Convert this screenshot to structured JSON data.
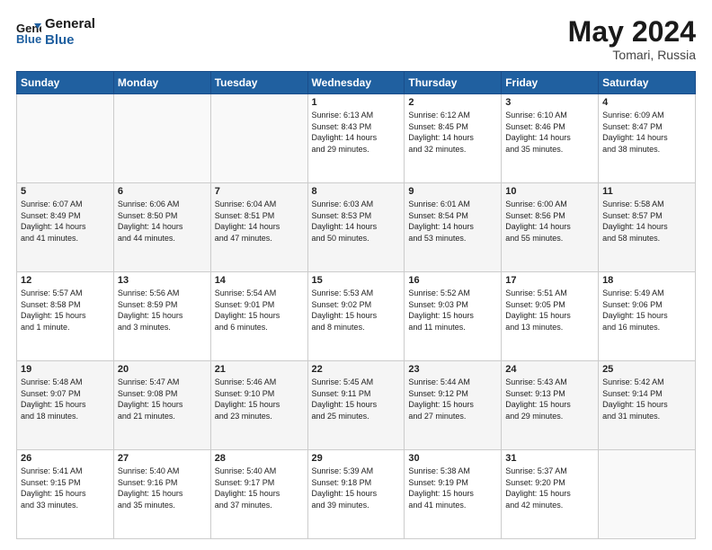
{
  "header": {
    "logo_line1": "General",
    "logo_line2": "Blue",
    "month_year": "May 2024",
    "location": "Tomari, Russia"
  },
  "weekdays": [
    "Sunday",
    "Monday",
    "Tuesday",
    "Wednesday",
    "Thursday",
    "Friday",
    "Saturday"
  ],
  "weeks": [
    [
      {
        "day": "",
        "info": ""
      },
      {
        "day": "",
        "info": ""
      },
      {
        "day": "",
        "info": ""
      },
      {
        "day": "1",
        "info": "Sunrise: 6:13 AM\nSunset: 8:43 PM\nDaylight: 14 hours\nand 29 minutes."
      },
      {
        "day": "2",
        "info": "Sunrise: 6:12 AM\nSunset: 8:45 PM\nDaylight: 14 hours\nand 32 minutes."
      },
      {
        "day": "3",
        "info": "Sunrise: 6:10 AM\nSunset: 8:46 PM\nDaylight: 14 hours\nand 35 minutes."
      },
      {
        "day": "4",
        "info": "Sunrise: 6:09 AM\nSunset: 8:47 PM\nDaylight: 14 hours\nand 38 minutes."
      }
    ],
    [
      {
        "day": "5",
        "info": "Sunrise: 6:07 AM\nSunset: 8:49 PM\nDaylight: 14 hours\nand 41 minutes."
      },
      {
        "day": "6",
        "info": "Sunrise: 6:06 AM\nSunset: 8:50 PM\nDaylight: 14 hours\nand 44 minutes."
      },
      {
        "day": "7",
        "info": "Sunrise: 6:04 AM\nSunset: 8:51 PM\nDaylight: 14 hours\nand 47 minutes."
      },
      {
        "day": "8",
        "info": "Sunrise: 6:03 AM\nSunset: 8:53 PM\nDaylight: 14 hours\nand 50 minutes."
      },
      {
        "day": "9",
        "info": "Sunrise: 6:01 AM\nSunset: 8:54 PM\nDaylight: 14 hours\nand 53 minutes."
      },
      {
        "day": "10",
        "info": "Sunrise: 6:00 AM\nSunset: 8:56 PM\nDaylight: 14 hours\nand 55 minutes."
      },
      {
        "day": "11",
        "info": "Sunrise: 5:58 AM\nSunset: 8:57 PM\nDaylight: 14 hours\nand 58 minutes."
      }
    ],
    [
      {
        "day": "12",
        "info": "Sunrise: 5:57 AM\nSunset: 8:58 PM\nDaylight: 15 hours\nand 1 minute."
      },
      {
        "day": "13",
        "info": "Sunrise: 5:56 AM\nSunset: 8:59 PM\nDaylight: 15 hours\nand 3 minutes."
      },
      {
        "day": "14",
        "info": "Sunrise: 5:54 AM\nSunset: 9:01 PM\nDaylight: 15 hours\nand 6 minutes."
      },
      {
        "day": "15",
        "info": "Sunrise: 5:53 AM\nSunset: 9:02 PM\nDaylight: 15 hours\nand 8 minutes."
      },
      {
        "day": "16",
        "info": "Sunrise: 5:52 AM\nSunset: 9:03 PM\nDaylight: 15 hours\nand 11 minutes."
      },
      {
        "day": "17",
        "info": "Sunrise: 5:51 AM\nSunset: 9:05 PM\nDaylight: 15 hours\nand 13 minutes."
      },
      {
        "day": "18",
        "info": "Sunrise: 5:49 AM\nSunset: 9:06 PM\nDaylight: 15 hours\nand 16 minutes."
      }
    ],
    [
      {
        "day": "19",
        "info": "Sunrise: 5:48 AM\nSunset: 9:07 PM\nDaylight: 15 hours\nand 18 minutes."
      },
      {
        "day": "20",
        "info": "Sunrise: 5:47 AM\nSunset: 9:08 PM\nDaylight: 15 hours\nand 21 minutes."
      },
      {
        "day": "21",
        "info": "Sunrise: 5:46 AM\nSunset: 9:10 PM\nDaylight: 15 hours\nand 23 minutes."
      },
      {
        "day": "22",
        "info": "Sunrise: 5:45 AM\nSunset: 9:11 PM\nDaylight: 15 hours\nand 25 minutes."
      },
      {
        "day": "23",
        "info": "Sunrise: 5:44 AM\nSunset: 9:12 PM\nDaylight: 15 hours\nand 27 minutes."
      },
      {
        "day": "24",
        "info": "Sunrise: 5:43 AM\nSunset: 9:13 PM\nDaylight: 15 hours\nand 29 minutes."
      },
      {
        "day": "25",
        "info": "Sunrise: 5:42 AM\nSunset: 9:14 PM\nDaylight: 15 hours\nand 31 minutes."
      }
    ],
    [
      {
        "day": "26",
        "info": "Sunrise: 5:41 AM\nSunset: 9:15 PM\nDaylight: 15 hours\nand 33 minutes."
      },
      {
        "day": "27",
        "info": "Sunrise: 5:40 AM\nSunset: 9:16 PM\nDaylight: 15 hours\nand 35 minutes."
      },
      {
        "day": "28",
        "info": "Sunrise: 5:40 AM\nSunset: 9:17 PM\nDaylight: 15 hours\nand 37 minutes."
      },
      {
        "day": "29",
        "info": "Sunrise: 5:39 AM\nSunset: 9:18 PM\nDaylight: 15 hours\nand 39 minutes."
      },
      {
        "day": "30",
        "info": "Sunrise: 5:38 AM\nSunset: 9:19 PM\nDaylight: 15 hours\nand 41 minutes."
      },
      {
        "day": "31",
        "info": "Sunrise: 5:37 AM\nSunset: 9:20 PM\nDaylight: 15 hours\nand 42 minutes."
      },
      {
        "day": "",
        "info": ""
      }
    ]
  ]
}
